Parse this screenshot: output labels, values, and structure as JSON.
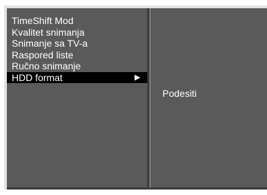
{
  "menu": {
    "items": [
      {
        "label": "TimeShift Mod"
      },
      {
        "label": "Kvalitet snimanja"
      },
      {
        "label": "Snimanje sa TV-a"
      },
      {
        "label": "Raspored liste"
      },
      {
        "label": "Ručno snimanje"
      },
      {
        "label": "HDD format",
        "selected": true,
        "arrow": "▶"
      }
    ]
  },
  "submenu": {
    "items": [
      {
        "label": "Podesiti"
      }
    ]
  },
  "colors": {
    "background": "#5a5a5a",
    "selected": "#000000",
    "text": "#ffffff",
    "frame_highlight": "#e2e2e2"
  },
  "icons": {
    "submenu_arrow": "triangle-right-icon"
  }
}
